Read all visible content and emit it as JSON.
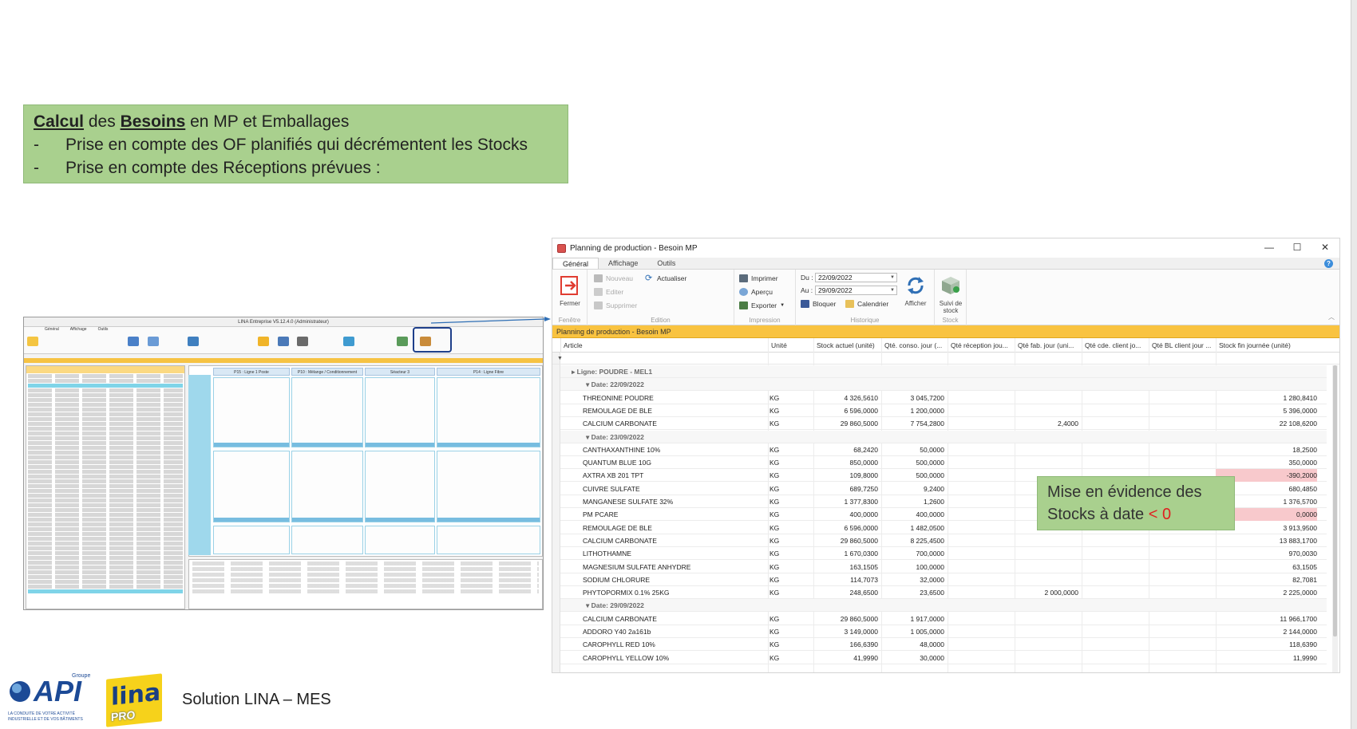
{
  "callout": {
    "line1_a": "Calcul",
    "line1_b": " des ",
    "line1_c": "Besoins",
    "line1_d": " en MP et Emballages",
    "bullets": [
      {
        "dash": "-",
        "text": "Prise en compte des OF planifiés qui décrémentent les Stocks"
      },
      {
        "dash": "-",
        "text": "Prise en compte des Réceptions prévues  :"
      }
    ]
  },
  "mini_window": {
    "title": "LINA Entreprise V5.12.4.0 (Administrateur)",
    "tabs": [
      "Général",
      "Affichage",
      "Outils"
    ],
    "columns": [
      "P15 : Ligne 1 Poste",
      "P10 : Mélange / Conditionnement",
      "Séacteur 3",
      "P14 : Ligne Fibre"
    ]
  },
  "window": {
    "title": "Planning de production - Besoin MP",
    "tabs": [
      "Général",
      "Affichage",
      "Outils"
    ],
    "help": "?",
    "controls": {
      "minimize": "—",
      "maximize": "☐",
      "close": "✕"
    },
    "ribbon": {
      "fermer": "Fermer",
      "nouveau": "Nouveau",
      "actualiser": "Actualiser",
      "editer": "Editer",
      "supprimer": "Supprimer",
      "imprimer": "Imprimer",
      "apercu": "Aperçu",
      "exporter": "Exporter",
      "du_label": "Du :",
      "du_value": "22/09/2022",
      "au_label": "Au :",
      "au_value": "29/09/2022",
      "bloquer": "Bloquer",
      "calendrier": "Calendrier",
      "afficher": "Afficher",
      "suivi1": "Suivi de",
      "suivi2": "stock",
      "groups": [
        "Fenêtre",
        "Edition",
        "Impression",
        "Historique",
        "Stock"
      ]
    },
    "panel_title": "Planning de production - Besoin MP",
    "columns": [
      "Article",
      "Unité",
      "Stock actuel (unité)",
      "Qté. conso. jour (...",
      "Qté réception jou...",
      "Qté fab. jour (uni...",
      "Qté cde. client jo...",
      "Qté BL client jour ...",
      "Stock fin journée (unité)"
    ],
    "rows": [
      {
        "type": "line",
        "label": "Ligne: POUDRE - MEL1"
      },
      {
        "type": "date",
        "label": "Date: 22/09/2022"
      },
      {
        "type": "item",
        "article": "THREONINE POUDRE",
        "unit": "KG",
        "stock": "4 326,5610",
        "conso": "3 045,7200",
        "recep": "",
        "fab": "",
        "cde": "",
        "bl": "",
        "fin": "1 280,8410"
      },
      {
        "type": "item",
        "article": "REMOULAGE DE BLE",
        "unit": "KG",
        "stock": "6 596,0000",
        "conso": "1 200,0000",
        "recep": "",
        "fab": "",
        "cde": "",
        "bl": "",
        "fin": "5 396,0000"
      },
      {
        "type": "item",
        "article": "CALCIUM CARBONATE",
        "unit": "KG",
        "stock": "29 860,5000",
        "conso": "7 754,2800",
        "recep": "",
        "fab": "2,4000",
        "cde": "",
        "bl": "",
        "fin": "22 108,6200"
      },
      {
        "type": "date",
        "label": "Date: 23/09/2022"
      },
      {
        "type": "item",
        "article": "CANTHAXANTHINE 10%",
        "unit": "KG",
        "stock": "68,2420",
        "conso": "50,0000",
        "recep": "",
        "fab": "",
        "cde": "",
        "bl": "",
        "fin": "18,2500"
      },
      {
        "type": "item",
        "article": "QUANTUM BLUE 10G",
        "unit": "KG",
        "stock": "850,0000",
        "conso": "500,0000",
        "recep": "",
        "fab": "",
        "cde": "",
        "bl": "",
        "fin": "350,0000"
      },
      {
        "type": "item",
        "article": "AXTRA XB 201 TPT",
        "unit": "KG",
        "stock": "109,8000",
        "conso": "500,0000",
        "recep": "",
        "fab": "",
        "cde": "",
        "bl": "",
        "fin": "-390,2000",
        "neg": true
      },
      {
        "type": "item",
        "article": "CUIVRE SULFATE",
        "unit": "KG",
        "stock": "689,7250",
        "conso": "9,2400",
        "recep": "",
        "fab": "",
        "cde": "",
        "bl": "",
        "fin": "680,4850"
      },
      {
        "type": "item",
        "article": "MANGANESE SULFATE 32%",
        "unit": "KG",
        "stock": "1 377,8300",
        "conso": "1,2600",
        "recep": "",
        "fab": "",
        "cde": "",
        "bl": "",
        "fin": "1 376,5700"
      },
      {
        "type": "item",
        "article": "PM PCARE",
        "unit": "KG",
        "stock": "400,0000",
        "conso": "400,0000",
        "recep": "",
        "fab": "",
        "cde": "",
        "bl": "",
        "fin": "0,0000",
        "neg": true
      },
      {
        "type": "item",
        "article": "REMOULAGE DE BLE",
        "unit": "KG",
        "stock": "6 596,0000",
        "conso": "1 482,0500",
        "recep": "",
        "fab": "",
        "cde": "",
        "bl": "",
        "fin": "3 913,9500"
      },
      {
        "type": "item",
        "article": "CALCIUM CARBONATE",
        "unit": "KG",
        "stock": "29 860,5000",
        "conso": "8 225,4500",
        "recep": "",
        "fab": "",
        "cde": "",
        "bl": "",
        "fin": "13 883,1700"
      },
      {
        "type": "item",
        "article": "LITHOTHAMNE",
        "unit": "KG",
        "stock": "1 670,0300",
        "conso": "700,0000",
        "recep": "",
        "fab": "",
        "cde": "",
        "bl": "",
        "fin": "970,0030"
      },
      {
        "type": "item",
        "article": "MAGNESIUM SULFATE ANHYDRE",
        "unit": "KG",
        "stock": "163,1505",
        "conso": "100,0000",
        "recep": "",
        "fab": "",
        "cde": "",
        "bl": "",
        "fin": "63,1505"
      },
      {
        "type": "item",
        "article": "SODIUM CHLORURE",
        "unit": "KG",
        "stock": "114,7073",
        "conso": "32,0000",
        "recep": "",
        "fab": "",
        "cde": "",
        "bl": "",
        "fin": "82,7081"
      },
      {
        "type": "item",
        "article": "PHYTOPORMIX 0.1% 25KG",
        "unit": "KG",
        "stock": "248,6500",
        "conso": "23,6500",
        "recep": "",
        "fab": "2 000,0000",
        "cde": "",
        "bl": "",
        "fin": "2 225,0000"
      },
      {
        "type": "date",
        "label": "Date: 29/09/2022"
      },
      {
        "type": "item",
        "article": "CALCIUM CARBONATE",
        "unit": "KG",
        "stock": "29 860,5000",
        "conso": "1 917,0000",
        "recep": "",
        "fab": "",
        "cde": "",
        "bl": "",
        "fin": "11 966,1700"
      },
      {
        "type": "item",
        "article": "ADDORO Y40 2a161b",
        "unit": "KG",
        "stock": "3 149,0000",
        "conso": "1 005,0000",
        "recep": "",
        "fab": "",
        "cde": "",
        "bl": "",
        "fin": "2 144,0000"
      },
      {
        "type": "item",
        "article": "CAROPHYLL RED 10%",
        "unit": "KG",
        "stock": "166,6390",
        "conso": "48,0000",
        "recep": "",
        "fab": "",
        "cde": "",
        "bl": "",
        "fin": "118,6390"
      },
      {
        "type": "item",
        "article": "CAROPHYLL YELLOW 10%",
        "unit": "KG",
        "stock": "41,9990",
        "conso": "30,0000",
        "recep": "",
        "fab": "",
        "cde": "",
        "bl": "",
        "fin": "11,9990"
      }
    ]
  },
  "callout2": {
    "line1": "Mise en évidence des",
    "line2a": "Stocks à date ",
    "line2b": "< 0"
  },
  "footer": {
    "api": "API",
    "groupe": "Groupe",
    "tagline1": "LA CONDUITE DE VOTRE ACTIVITÉ",
    "tagline2": "INDUSTRIELLE ET DE VOS BÂTIMENTS",
    "lina": "lina",
    "pro": "PRO",
    "solution": "Solution LINA – MES"
  },
  "colors": {
    "accent_orange": "#f9c340",
    "callout_green": "#a9d08e",
    "negative": "#f8c9cc"
  }
}
